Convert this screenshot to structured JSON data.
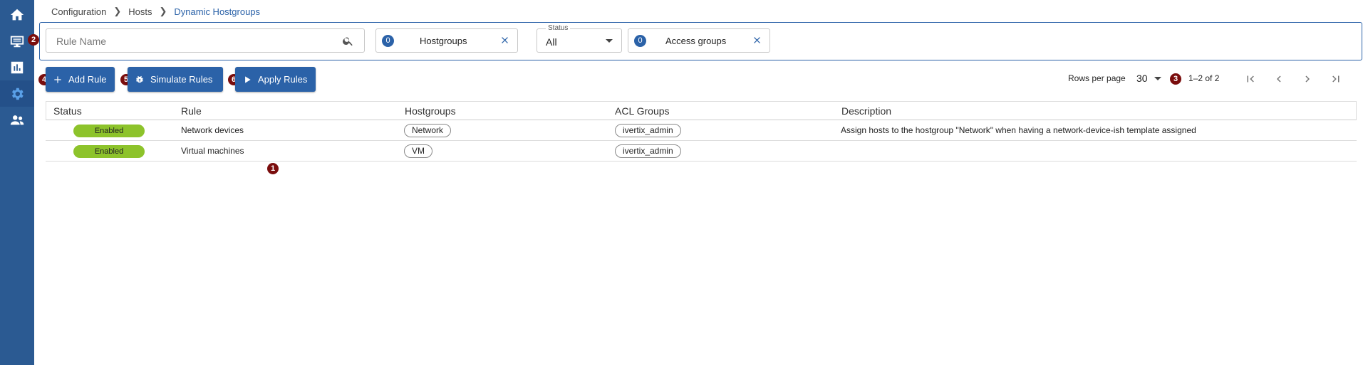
{
  "sidebar": {
    "items": [
      {
        "icon": "home-icon"
      },
      {
        "icon": "monitor-icon"
      },
      {
        "icon": "chart-icon"
      },
      {
        "icon": "gear-icon"
      },
      {
        "icon": "users-icon"
      }
    ]
  },
  "breadcrumb": {
    "items": [
      "Configuration",
      "Hosts",
      "Dynamic Hostgroups"
    ]
  },
  "filters": {
    "search_placeholder": "Rule Name",
    "hostgroups": {
      "count": "0",
      "label": "Hostgroups"
    },
    "status": {
      "legend": "Status",
      "value": "All"
    },
    "access_groups": {
      "count": "0",
      "label": "Access groups"
    }
  },
  "toolbar": {
    "add_label": "Add Rule",
    "simulate_label": "Simulate Rules",
    "apply_label": "Apply Rules"
  },
  "pagination": {
    "rows_per_page_label": "Rows per page",
    "rows_per_page": "30",
    "range": "1–2 of 2"
  },
  "annotations": {
    "b1": "1",
    "b2": "2",
    "b3": "3",
    "b4": "4",
    "b5": "5",
    "b6": "6"
  },
  "table": {
    "columns": [
      "Status",
      "Rule",
      "Hostgroups",
      "ACL Groups",
      "Description"
    ],
    "rows": [
      {
        "status": "Enabled",
        "rule": "Network devices",
        "hostgroup": "Network",
        "acl": "ivertix_admin",
        "description": "Assign hosts to the hostgroup \"Network\" when having a network-device-ish template assigned"
      },
      {
        "status": "Enabled",
        "rule": "Virtual machines",
        "hostgroup": "VM",
        "acl": "ivertix_admin",
        "description": ""
      }
    ]
  },
  "colors": {
    "sidebar": "#2b5a92",
    "accent": "#2b62a8",
    "enabled": "#8dc32b",
    "badge": "#7a0d0d"
  }
}
